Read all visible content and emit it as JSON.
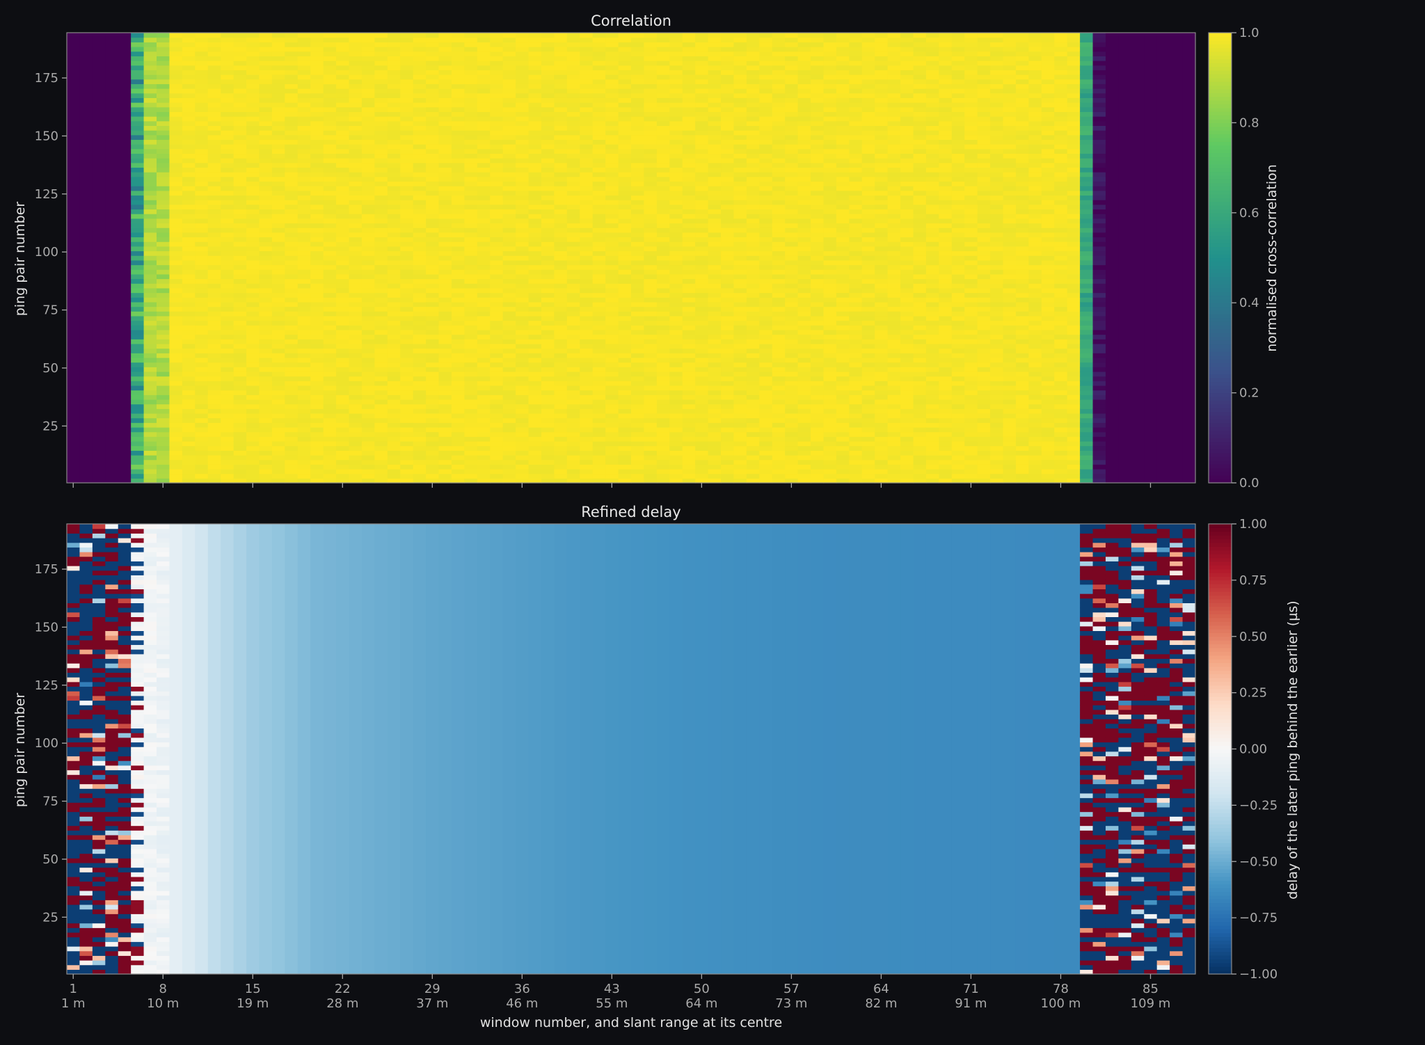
{
  "chart_data": [
    {
      "type": "heatmap",
      "title": "Correlation",
      "ylabel": "ping pair number",
      "xlabel": "",
      "x_range": [
        0.5,
        88.5
      ],
      "y_range": [
        0.5,
        194.5
      ],
      "yticks": [
        25,
        50,
        75,
        100,
        125,
        150,
        175
      ],
      "xticks": [
        1,
        8,
        15,
        22,
        29,
        36,
        43,
        50,
        57,
        64,
        71,
        78,
        85
      ],
      "show_xticklabels": false,
      "colormap": "viridis",
      "colorbar": {
        "label": "normalised cross-correlation",
        "range": [
          0.0,
          1.0
        ],
        "ticks": [
          0.0,
          0.2,
          0.4,
          0.6,
          0.8,
          1.0
        ],
        "tick_labels": [
          "0.0",
          "0.2",
          "0.4",
          "0.6",
          "0.8",
          "1.0"
        ]
      },
      "column_profile": [
        {
          "from": 1,
          "to": 5,
          "value": 0.0
        },
        {
          "from": 6,
          "to": 6,
          "value": 0.6,
          "noise": 0.12
        },
        {
          "from": 7,
          "to": 8,
          "value": 0.88,
          "noise": 0.04
        },
        {
          "from": 9,
          "to": 79,
          "value": 0.99,
          "noise": 0.01
        },
        {
          "from": 80,
          "to": 80,
          "value": 0.6,
          "noise": 0.04
        },
        {
          "from": 81,
          "to": 81,
          "value": 0.05,
          "noise": 0.04
        },
        {
          "from": 82,
          "to": 88,
          "value": 0.0
        }
      ]
    },
    {
      "type": "heatmap",
      "title": "Refined delay",
      "ylabel": "ping pair number",
      "xlabel": "window number, and slant range at its centre",
      "x_range": [
        0.5,
        88.5
      ],
      "y_range": [
        0.5,
        194.5
      ],
      "yticks": [
        25,
        50,
        75,
        100,
        125,
        150,
        175
      ],
      "xticks": [
        1,
        8,
        15,
        22,
        29,
        36,
        43,
        50,
        57,
        64,
        71,
        78,
        85
      ],
      "xtick_labels": [
        "1",
        "8",
        "15",
        "22",
        "29",
        "36",
        "43",
        "50",
        "57",
        "64",
        "71",
        "78",
        "85"
      ],
      "xtick_sublabels": [
        "1 m",
        "10 m",
        "19 m",
        "28 m",
        "37 m",
        "46 m",
        "55 m",
        "64 m",
        "73 m",
        "82 m",
        "91 m",
        "100 m",
        "109 m"
      ],
      "colormap": "RdBu_r",
      "colorbar": {
        "label": "delay of the later ping behind the earlier (µs)",
        "range": [
          -1.0,
          1.0
        ],
        "ticks": [
          -1.0,
          -0.75,
          -0.5,
          -0.25,
          0.0,
          0.25,
          0.5,
          0.75,
          1.0
        ],
        "tick_labels": [
          "−1.00",
          "−0.75",
          "−0.50",
          "−0.25",
          "0.00",
          "0.25",
          "0.50",
          "0.75",
          "1.00"
        ]
      },
      "noise_columns": [
        [
          1,
          5
        ],
        [
          80,
          88
        ]
      ],
      "column_trend": {
        "start_window": 6,
        "start_value": -0.02,
        "trend": [
          [
            6,
            -0.02
          ],
          [
            8,
            -0.05
          ],
          [
            10,
            -0.15
          ],
          [
            12,
            -0.25
          ],
          [
            15,
            -0.36
          ],
          [
            20,
            -0.46
          ],
          [
            30,
            -0.53
          ],
          [
            40,
            -0.58
          ],
          [
            50,
            -0.61
          ],
          [
            60,
            -0.63
          ],
          [
            79,
            -0.64
          ]
        ]
      }
    }
  ]
}
